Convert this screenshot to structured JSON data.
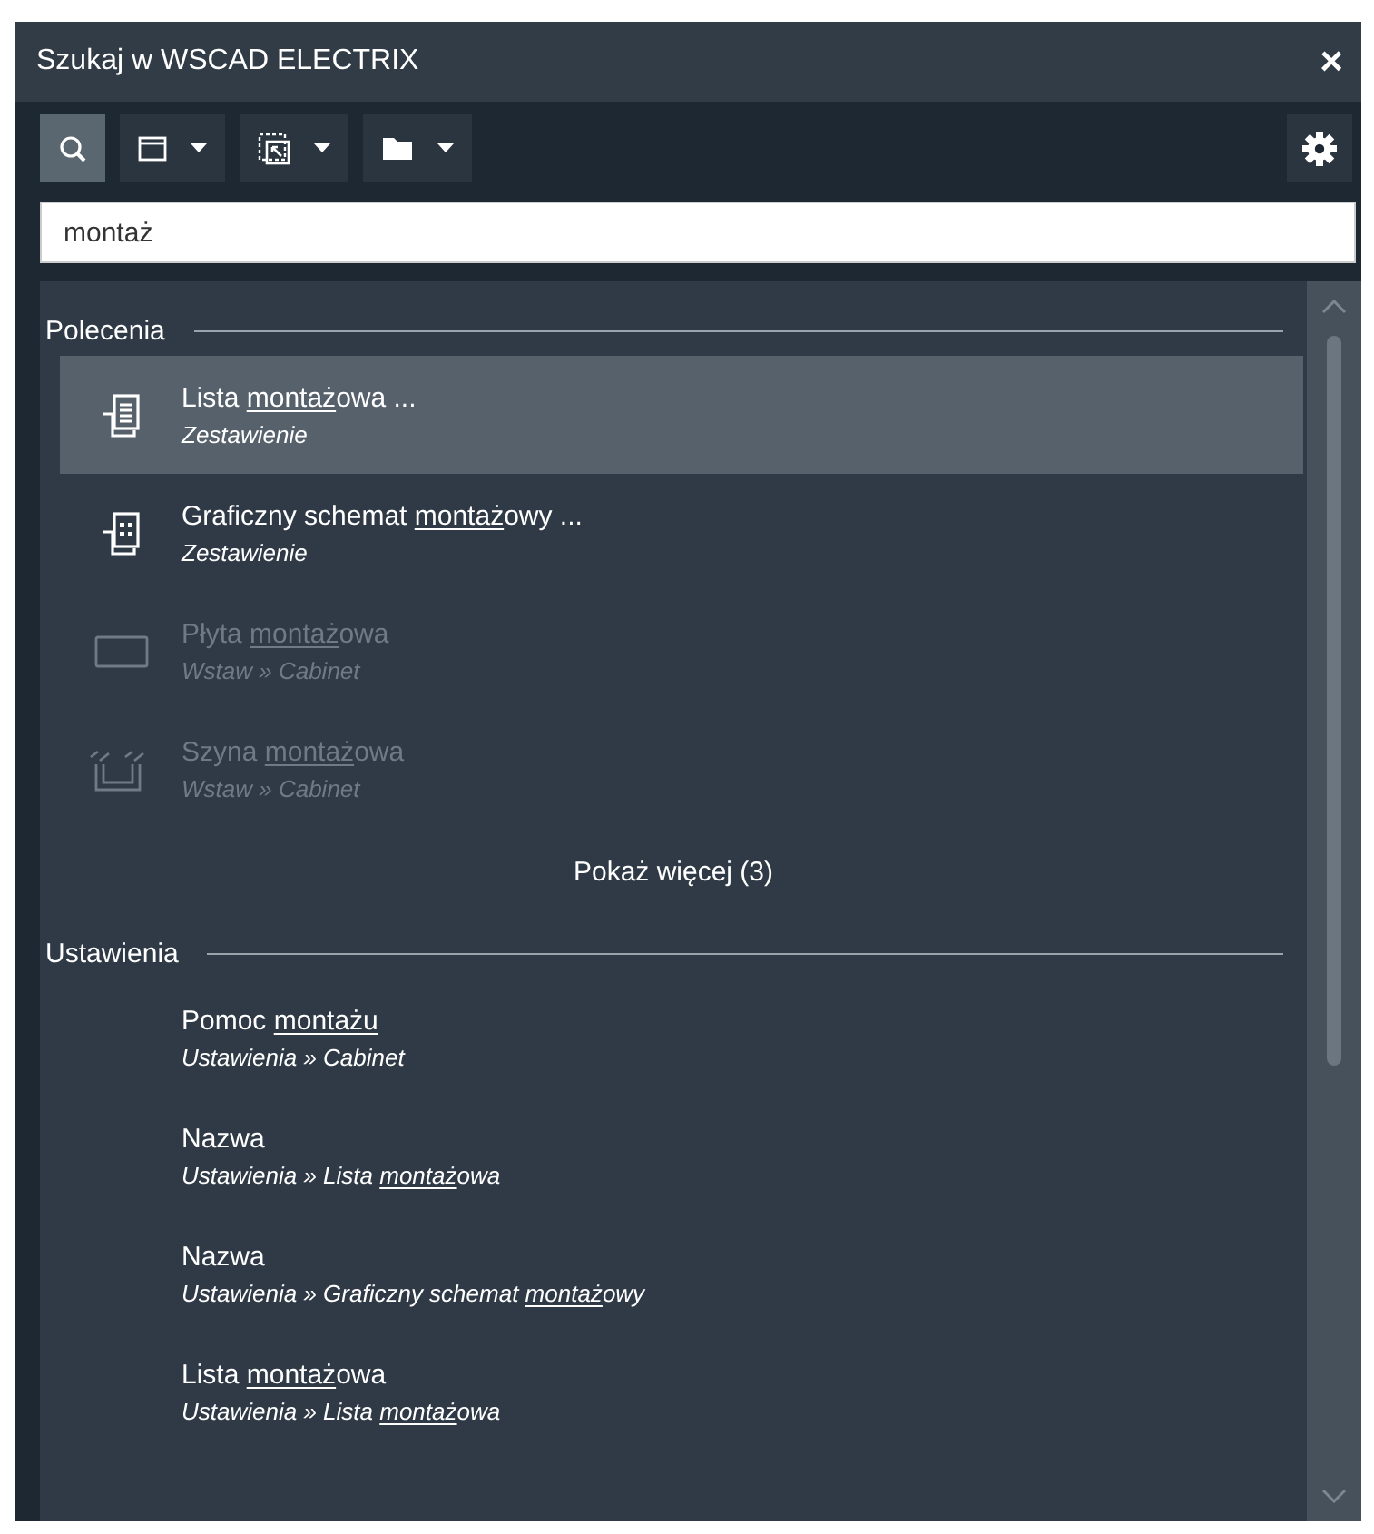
{
  "window": {
    "title": "Szukaj w WSCAD ELECTRIX",
    "close": "×"
  },
  "toolbar": {
    "buttons": [
      {
        "kind": "search",
        "selected": true,
        "dropdown": false
      },
      {
        "kind": "window",
        "selected": false,
        "dropdown": true
      },
      {
        "kind": "selection",
        "selected": false,
        "dropdown": true
      },
      {
        "kind": "folder",
        "selected": false,
        "dropdown": true
      }
    ]
  },
  "search": {
    "value": "montaż"
  },
  "sections": [
    {
      "title": "Polecenia",
      "items": [
        {
          "kind": "list",
          "selected": true,
          "disabled": false,
          "title": [
            {
              "text": "Lista ",
              "match": false
            },
            {
              "text": "montaż",
              "match": true
            },
            {
              "text": "owa ...",
              "match": false
            }
          ],
          "path": [
            {
              "text": "Zestawienie",
              "match": false
            }
          ]
        },
        {
          "kind": "layout",
          "selected": false,
          "disabled": false,
          "title": [
            {
              "text": "Graficzny schemat ",
              "match": false
            },
            {
              "text": "montaż",
              "match": true
            },
            {
              "text": "owy ...",
              "match": false
            }
          ],
          "path": [
            {
              "text": "Zestawienie",
              "match": false
            }
          ]
        },
        {
          "kind": "plate",
          "selected": false,
          "disabled": true,
          "title": [
            {
              "text": "Płyta ",
              "match": false
            },
            {
              "text": "montaż",
              "match": true
            },
            {
              "text": "owa",
              "match": false
            }
          ],
          "path": [
            {
              "text": "Wstaw » Cabinet",
              "match": false
            }
          ]
        },
        {
          "kind": "rail",
          "selected": false,
          "disabled": true,
          "title": [
            {
              "text": "Szyna ",
              "match": false
            },
            {
              "text": "montaż",
              "match": true
            },
            {
              "text": "owa",
              "match": false
            }
          ],
          "path": [
            {
              "text": "Wstaw » Cabinet",
              "match": false
            }
          ]
        }
      ],
      "more": "Pokaż więcej (3)"
    },
    {
      "title": "Ustawienia",
      "items": [
        {
          "kind": "none",
          "selected": false,
          "disabled": false,
          "title": [
            {
              "text": "Pomoc ",
              "match": false
            },
            {
              "text": "montażu",
              "match": true
            }
          ],
          "path": [
            {
              "text": "Ustawienia » Cabinet",
              "match": false
            }
          ]
        },
        {
          "kind": "none",
          "selected": false,
          "disabled": false,
          "title": [
            {
              "text": "Nazwa",
              "match": false
            }
          ],
          "path": [
            {
              "text": "Ustawienia » Lista ",
              "match": false
            },
            {
              "text": "montaż",
              "match": true
            },
            {
              "text": "owa",
              "match": false
            }
          ]
        },
        {
          "kind": "none",
          "selected": false,
          "disabled": false,
          "title": [
            {
              "text": "Nazwa",
              "match": false
            }
          ],
          "path": [
            {
              "text": "Ustawienia » Graficzny schemat ",
              "match": false
            },
            {
              "text": "montaż",
              "match": true
            },
            {
              "text": "owy",
              "match": false
            }
          ]
        },
        {
          "kind": "none",
          "selected": false,
          "disabled": false,
          "title": [
            {
              "text": "Lista ",
              "match": false
            },
            {
              "text": "montaż",
              "match": true
            },
            {
              "text": "owa",
              "match": false
            }
          ],
          "path": [
            {
              "text": "Ustawienia » Lista ",
              "match": false
            },
            {
              "text": "montaż",
              "match": true
            },
            {
              "text": "owa",
              "match": false
            }
          ]
        }
      ]
    }
  ]
}
